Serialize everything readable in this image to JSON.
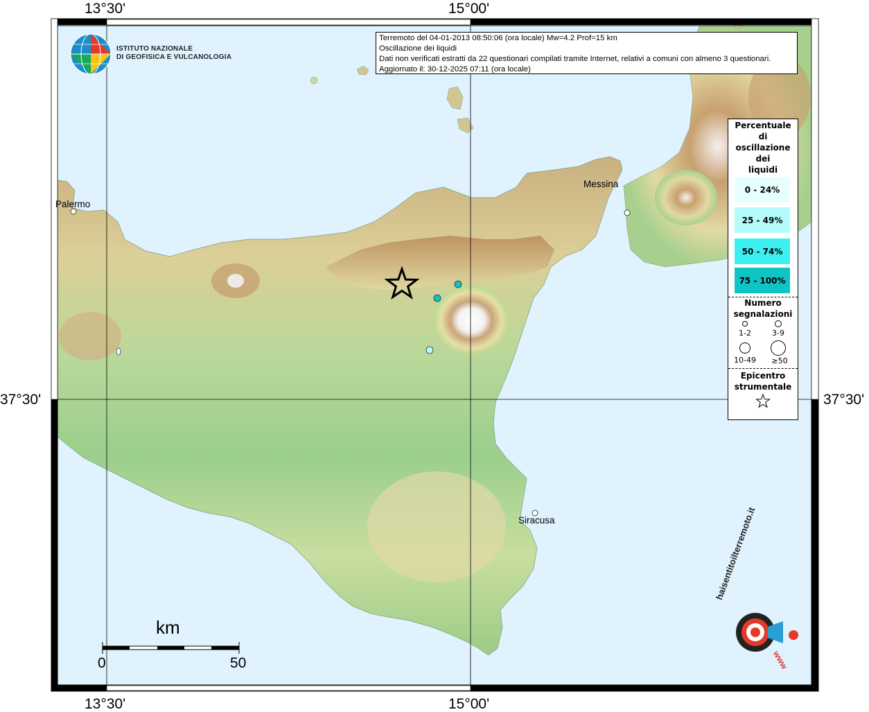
{
  "axes": {
    "top_left_lon": "13°30'",
    "top_mid_lon": "15°00'",
    "bottom_left_lon": "13°30'",
    "bottom_mid_lon": "15°00'",
    "left_lat": "37°30'",
    "right_lat": "37°30'"
  },
  "header_logo": {
    "line1": "ISTITUTO NAZIONALE",
    "line2": "DI GEOFISICA E VULCANOLOGIA"
  },
  "info": {
    "line1": "Terremoto del 04-01-2013 08:50:06 (ora locale) Mw=4.2 Prof=15 km",
    "line2": "Oscillazione dei liquidi",
    "line3": "Dati non verificati estratti da 22 questionari compilati tramite Internet, relativi a comuni con almeno 3 questionari.",
    "line4": "Aggiornato il: 30-12-2025 07:11 (ora locale)"
  },
  "legend": {
    "title_lines": [
      "Percentuale",
      "di",
      "oscillazione",
      "dei",
      "liquidi"
    ],
    "classes": [
      {
        "label": "0 - 24%",
        "color": "#e8ffff"
      },
      {
        "label": "25 - 49%",
        "color": "#b4fcfc"
      },
      {
        "label": "50 - 74%",
        "color": "#3cf0f0"
      },
      {
        "label": "75 - 100%",
        "color": "#10c4c4"
      }
    ],
    "count_title_lines": [
      "Numero",
      "segnalazioni"
    ],
    "count_classes": [
      "1-2",
      "3-9",
      "10-49",
      "≥50"
    ],
    "epicenter_title_lines": [
      "Epicentro",
      "strumentale"
    ]
  },
  "cities": {
    "palermo": "Palermo",
    "messina": "Messina",
    "siracusa": "Siracusa"
  },
  "scalebar": {
    "unit": "km",
    "start": "0",
    "end": "50"
  },
  "watermark": {
    "text": "haisentitoilterremoto.it",
    "url": "www"
  },
  "observations": [
    {
      "class_index": 3,
      "reports_class": "1-2"
    },
    {
      "class_index": 3,
      "reports_class": "1-2"
    },
    {
      "class_index": 1,
      "reports_class": "1-2"
    }
  ],
  "colors": {
    "sea": "#dff2fd",
    "land_low": "#8fc98c",
    "land_mid": "#e6dfa8",
    "land_high": "#c8a472",
    "peak": "#f4f4f4"
  }
}
